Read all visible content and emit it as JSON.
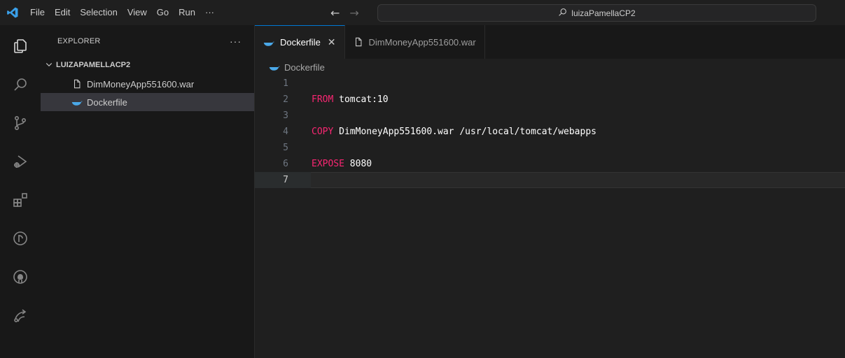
{
  "titlebar": {
    "menu": [
      "File",
      "Edit",
      "Selection",
      "View",
      "Go",
      "Run",
      "···"
    ],
    "back_arrow": "←",
    "forward_arrow": "→",
    "search_label": "luizaPamellaCP2"
  },
  "activitybar": {
    "icons": [
      "explorer-icon",
      "search-icon",
      "source-control-icon",
      "run-debug-icon",
      "extensions-icon",
      "timeline-icon",
      "github-icon",
      "remote-icon"
    ]
  },
  "sidebar": {
    "title": "EXPLORER",
    "more": "···",
    "folder": "LUIZAPAMELLACP2",
    "files": [
      {
        "name": "DimMoneyApp551600.war",
        "icon": "file-icon"
      },
      {
        "name": "Dockerfile",
        "icon": "docker-icon"
      }
    ]
  },
  "editor": {
    "tabs": [
      {
        "label": "Dockerfile",
        "close": "✕",
        "icon": "docker-icon",
        "active": true
      },
      {
        "label": "DimMoneyApp551600.war",
        "icon": "file-icon",
        "active": false
      }
    ],
    "breadcrumb": "Dockerfile",
    "lines": [
      {
        "num": "1",
        "keyword": "",
        "rest": ""
      },
      {
        "num": "2",
        "keyword": "FROM",
        "rest": " tomcat:10"
      },
      {
        "num": "3",
        "keyword": "",
        "rest": ""
      },
      {
        "num": "4",
        "keyword": "COPY",
        "rest": " DimMoneyApp551600.war /usr/local/tomcat/webapps"
      },
      {
        "num": "5",
        "keyword": "",
        "rest": ""
      },
      {
        "num": "6",
        "keyword": "EXPOSE",
        "rest": " 8080"
      },
      {
        "num": "7",
        "keyword": "",
        "rest": ""
      }
    ],
    "current_line": "7"
  },
  "colors": {
    "accent": "#0078d4",
    "keyword": "#f92672",
    "docker_blue": "#4aa8e8"
  }
}
